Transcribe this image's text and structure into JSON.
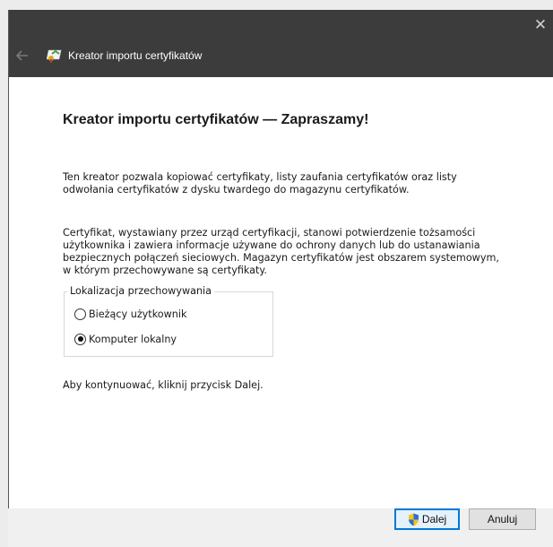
{
  "window": {
    "title": "Kreator importu certyfikatów",
    "close_glyph": "✕"
  },
  "content": {
    "heading": "Kreator importu certyfikatów — Zapraszamy!",
    "paragraph1": [
      "Ten kreator pozwala kopiować certyfikaty, listy zaufania certyfikatów oraz listy",
      "odwołania certyfikatów z dysku twardego do magazynu certyfikatów."
    ],
    "paragraph2": [
      "Certyfikat, wystawiany przez urząd certyfikacji, stanowi potwierdzenie tożsamości",
      "użytkownika i zawiera informacje używane do ochrony danych lub do ustanawiania",
      "bezpiecznych połączeń sieciowych. Magazyn certyfikatów jest obszarem systemowym,",
      "w którym przechowywane są certyfikaty."
    ],
    "store_location": {
      "legend": "Lokalizacja przechowywania",
      "options": [
        {
          "label": "Bieżący użytkownik",
          "checked": false
        },
        {
          "label": "Komputer lokalny",
          "checked": true
        }
      ]
    },
    "continue_text": "Aby kontynuować, kliknij przycisk Dalej."
  },
  "footer": {
    "next_label": "Dalej",
    "cancel_label": "Anuluj"
  },
  "colors": {
    "titlebar": "#3c3c3c",
    "accent": "#0078d7"
  }
}
